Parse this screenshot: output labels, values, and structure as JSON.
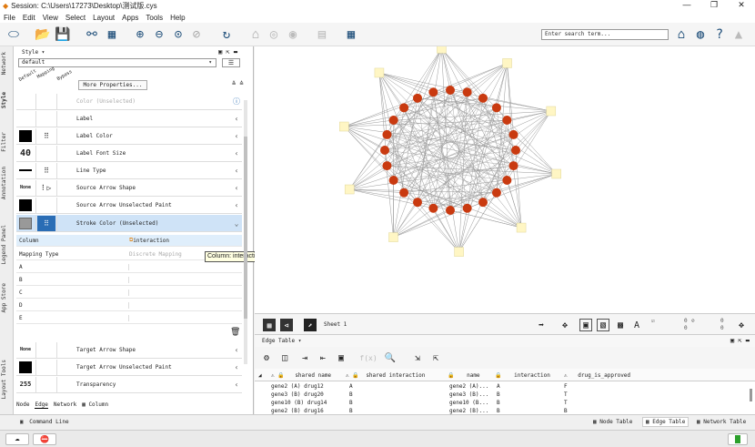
{
  "window": {
    "title": "Session: C:\\Users\\17273\\Desktop\\测试版.cys",
    "minimize": "—",
    "restore": "❐",
    "close": "✕"
  },
  "menu": [
    "File",
    "Edit",
    "View",
    "Select",
    "Layout",
    "Apps",
    "Tools",
    "Help"
  ],
  "search": {
    "placeholder": "Enter search term..."
  },
  "left_tabs": [
    "Network",
    "Style",
    "Filter",
    "Annotation",
    "Legend Panel",
    "App Store",
    "Layout Tools"
  ],
  "style_panel": {
    "title": "Style",
    "style_name": "default",
    "col_headers": [
      "Default",
      "Mapping",
      "Bypass"
    ],
    "more_properties": "More Properties...",
    "rows": [
      {
        "default": "",
        "label": "Color (Unselected)",
        "dimmed": true
      },
      {
        "default": "",
        "label": "Label"
      },
      {
        "default": "",
        "label": "Label Color"
      },
      {
        "default": "40",
        "label": "Label Font Size"
      },
      {
        "default": "",
        "label": "Line Type"
      },
      {
        "default": "None",
        "label": "Source Arrow Shape"
      },
      {
        "default": "",
        "label": "Source Arrow Unselected Paint"
      },
      {
        "default": "",
        "label": "Stroke Color (Unselected)"
      }
    ],
    "mapping": {
      "column_label": "Column",
      "column_value": "interaction",
      "type_label": "Mapping Type",
      "type_value": "Discrete Mapping",
      "tooltip": "Column: interaction",
      "keys": [
        "A",
        "B",
        "C",
        "D",
        "E"
      ]
    },
    "lower_rows": [
      {
        "default": "None",
        "label": "Target Arrow Shape"
      },
      {
        "default": "",
        "label": "Target Arrow Unselected Paint"
      },
      {
        "default": "255",
        "label": "Transparency"
      }
    ],
    "bottom_tabs": [
      "Node",
      "Edge",
      "Network",
      "Column"
    ]
  },
  "network_bar": {
    "sheet": "Sheet 1",
    "sel_a": "0",
    "sel_b": "0",
    "sel_c": "0",
    "sel_d": "0"
  },
  "edge_table": {
    "title": "Edge Table",
    "columns": [
      "shared name",
      "shared interaction",
      "name",
      "interaction",
      "drug_is_approved"
    ],
    "rows": [
      [
        "gene2 (A) drug12",
        "A",
        "gene2 (A)...",
        "A",
        "F"
      ],
      [
        "gene3 (B) drug20",
        "B",
        "gene3 (B)...",
        "B",
        "T"
      ],
      [
        "gene10 (B) drug14",
        "B",
        "gene10 (B...",
        "B",
        "T"
      ],
      [
        "gene2 (B) drug16",
        "B",
        "gene2 (B)...",
        "B",
        "B"
      ]
    ]
  },
  "command_line": "Command Line",
  "bottom_tables": [
    "Node Table",
    "Edge Table",
    "Network Table"
  ],
  "colors": {
    "node_red": "#c93a10",
    "node_yellow": "#fff6c4",
    "edge_gray": "#9a9a9a",
    "selected_row": "#cfe3f7",
    "accent": "#1f4f7a"
  }
}
